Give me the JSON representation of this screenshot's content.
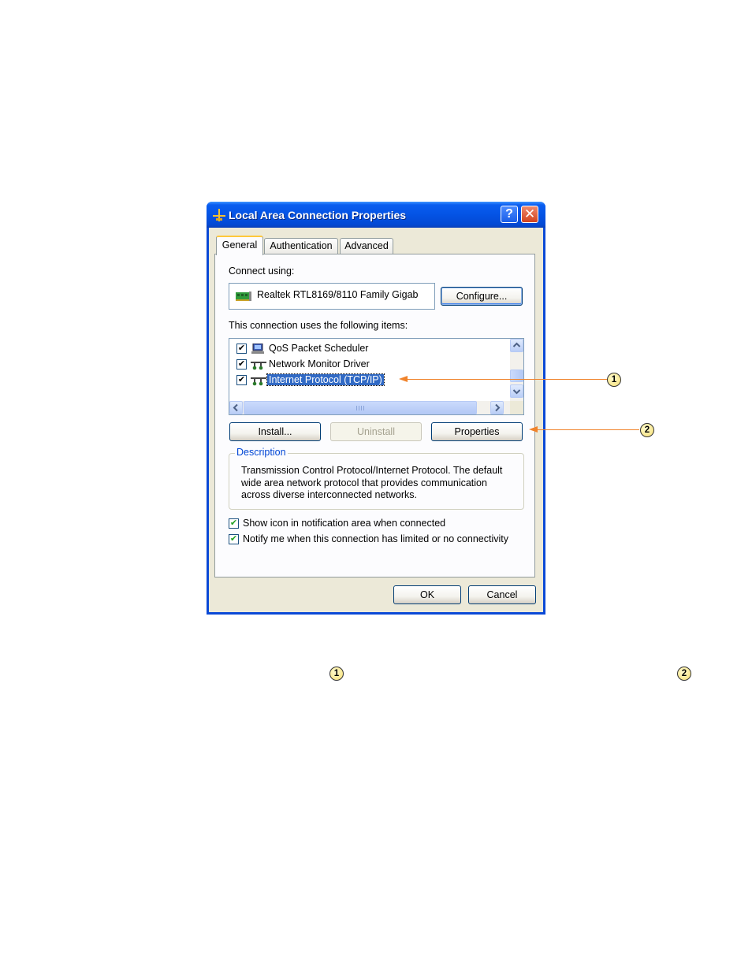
{
  "window": {
    "title": "Local Area Connection Properties",
    "help_label": "?",
    "close_label": "✕"
  },
  "tabs": [
    {
      "label": "General",
      "active": true
    },
    {
      "label": "Authentication",
      "active": false
    },
    {
      "label": "Advanced",
      "active": false
    }
  ],
  "general": {
    "connect_using_label": "Connect using:",
    "adapter_name": "Realtek RTL8169/8110 Family Gigab",
    "configure_label": "Configure...",
    "items_label": "This connection uses the following items:",
    "items": [
      {
        "label": "QoS Packet Scheduler",
        "checked": true,
        "icon": "qos-scheduler-icon",
        "selected": false
      },
      {
        "label": "Network Monitor Driver",
        "checked": true,
        "icon": "network-protocol-icon",
        "selected": false
      },
      {
        "label": "Internet Protocol (TCP/IP)",
        "checked": true,
        "icon": "network-protocol-icon",
        "selected": true
      }
    ],
    "install_label": "Install...",
    "uninstall_label": "Uninstall",
    "properties_label": "Properties",
    "description_title": "Description",
    "description_lines": [
      "Transmission Control Protocol/Internet Protocol. The default",
      "wide area network protocol that provides communication",
      "across diverse interconnected networks."
    ],
    "show_icon_label": "Show icon in notification area when connected",
    "show_icon_checked": true,
    "notify_label": "Notify me when this connection has limited or no connectivity",
    "notify_checked": true
  },
  "footer": {
    "ok_label": "OK",
    "cancel_label": "Cancel"
  },
  "callouts": {
    "one": "1",
    "two": "2"
  },
  "colors": {
    "callout": "#f0832b",
    "selection": "#316ac5",
    "titlebar": "#0453e4"
  }
}
